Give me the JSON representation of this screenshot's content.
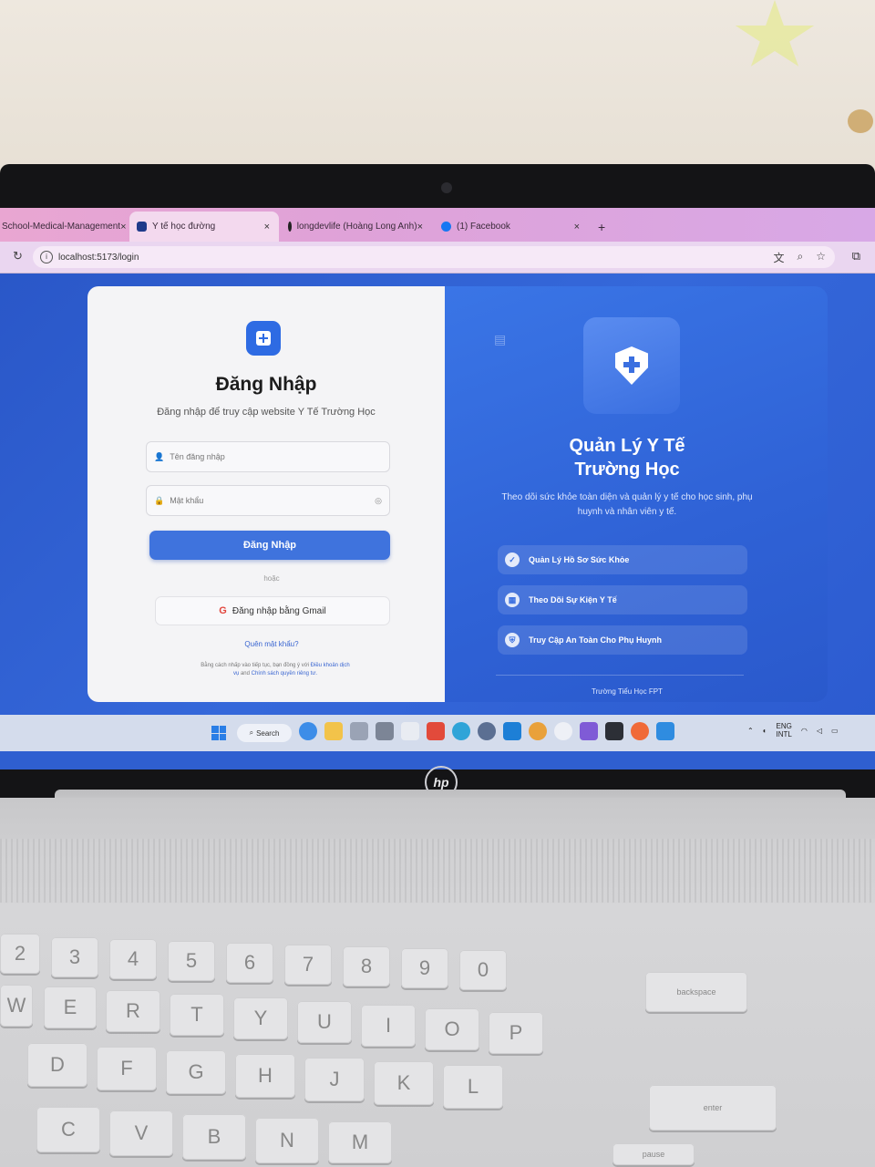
{
  "browser": {
    "tabs": [
      {
        "label": "School-Medical-Management",
        "favicon_color": "#e58a4a",
        "active": false
      },
      {
        "label": "Y tế học đường",
        "favicon_color": "#1e3a8a",
        "active": true
      },
      {
        "label": "longdevlife (Hoàng Long Anh)",
        "favicon_color": "#222222",
        "active": false
      },
      {
        "label": "(1) Facebook",
        "favicon_color": "#1877f2",
        "active": false
      }
    ],
    "close_glyph": "×",
    "new_tab_glyph": "+",
    "reload_glyph": "↻",
    "url": "localhost:5173/login"
  },
  "login": {
    "title": "Đăng Nhập",
    "subtitle": "Đăng nhập để truy cập website Y Tế Trường Học",
    "username_placeholder": "Tên đăng nhập",
    "password_placeholder": "Mật khẩu",
    "submit_label": "Đăng Nhập",
    "or_text": "hoặc",
    "gmail_label": "Đăng nhập bằng Gmail",
    "forgot_label": "Quên mật khẩu?",
    "terms_prefix": "Bằng cách nhấp vào tiếp tục, bạn đồng ý với",
    "terms_link": "Điều khoản dịch vụ",
    "terms_and": "and",
    "privacy_link": "Chính sách quyền riêng tư."
  },
  "promo": {
    "title": "Quản Lý Y Tế Trường Học",
    "description": "Theo dõi sức khỏe toàn diện và quản lý y tế cho học sinh, phụ huynh và nhân viên y tế.",
    "features": [
      {
        "label": "Quản Lý Hồ Sơ Sức Khỏe",
        "icon": "check-icon"
      },
      {
        "label": "Theo Dõi Sự Kiện Y Tế",
        "icon": "calendar-icon"
      },
      {
        "label": "Truy Cập An Toàn Cho Phụ Huynh",
        "icon": "shield-icon"
      }
    ],
    "footer": "Trường Tiểu Học FPT"
  },
  "taskbar": {
    "search_label": "Search",
    "lang_line1": "ENG",
    "lang_line2": "INTL"
  },
  "keyboard": {
    "row1": [
      "2",
      "3",
      "4",
      "5",
      "6",
      "7",
      "8",
      "9",
      "0"
    ],
    "row2": [
      "W",
      "E",
      "R",
      "T",
      "Y",
      "U",
      "I",
      "O",
      "P"
    ],
    "row3": [
      "D",
      "F",
      "G",
      "H",
      "J",
      "K",
      "L"
    ],
    "row4": [
      "C",
      "V",
      "B",
      "N",
      "M"
    ],
    "backspace": "backspace",
    "enter": "enter",
    "pause": "pause"
  },
  "colors": {
    "accent": "#3f73dd",
    "page_bg": "#2f5fd0"
  }
}
